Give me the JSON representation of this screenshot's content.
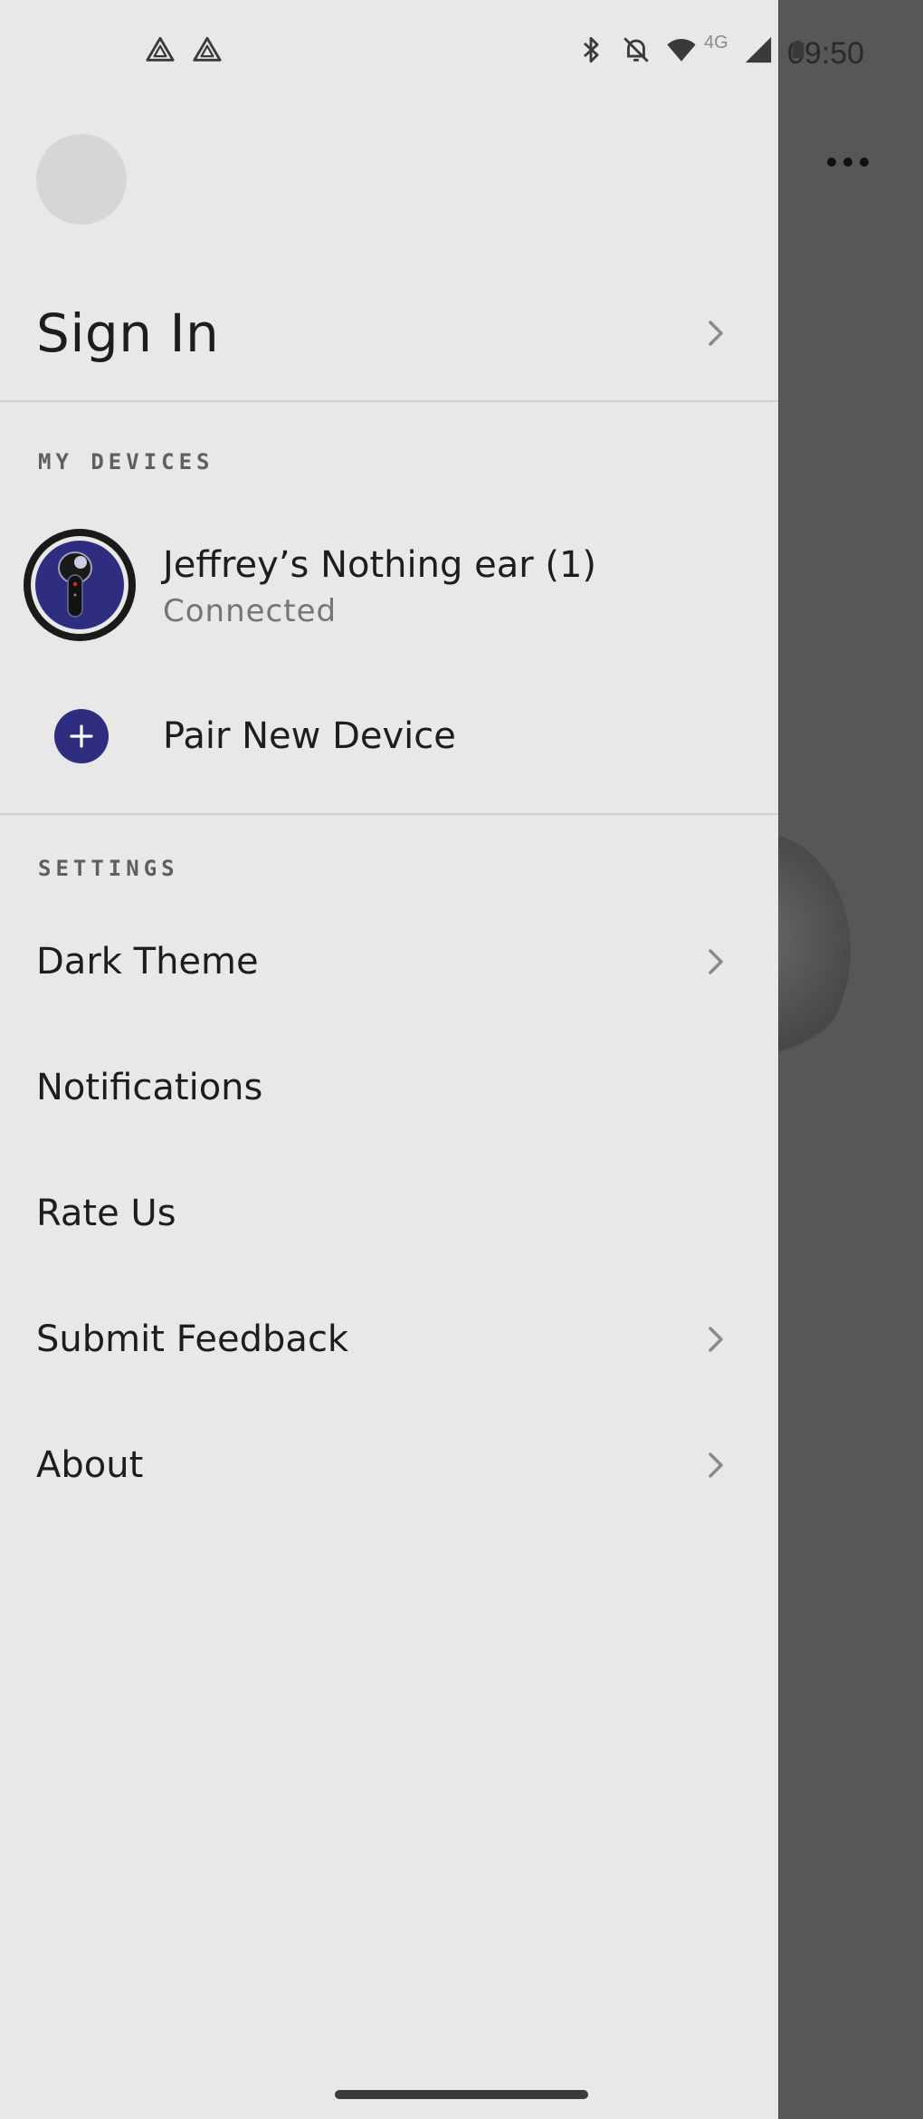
{
  "status_bar": {
    "time": "09:50",
    "network": "4G",
    "left_icons": [
      "drive-icon",
      "drive-icon"
    ],
    "right_icons": [
      "bluetooth-icon",
      "bell-off-icon",
      "wifi-icon",
      "cell-signal-icon",
      "battery-icon"
    ]
  },
  "drawer": {
    "sign_in_label": "Sign In",
    "my_devices_header": "MY DEVICES",
    "devices": [
      {
        "name": "Jeffrey’s Nothing ear (1)",
        "status": "Connected"
      }
    ],
    "pair_new_device_label": "Pair New Device",
    "settings_header": "SETTINGS",
    "settings_items": [
      {
        "label": "Dark Theme",
        "has_chevron": true
      },
      {
        "label": "Notifications",
        "has_chevron": false
      },
      {
        "label": "Rate Us",
        "has_chevron": false
      },
      {
        "label": "Submit Feedback",
        "has_chevron": true
      },
      {
        "label": "About",
        "has_chevron": true
      }
    ]
  },
  "colors": {
    "drawer_bg": "#e7e8e7",
    "accent": "#2e2d80",
    "scrim": "#575757"
  }
}
